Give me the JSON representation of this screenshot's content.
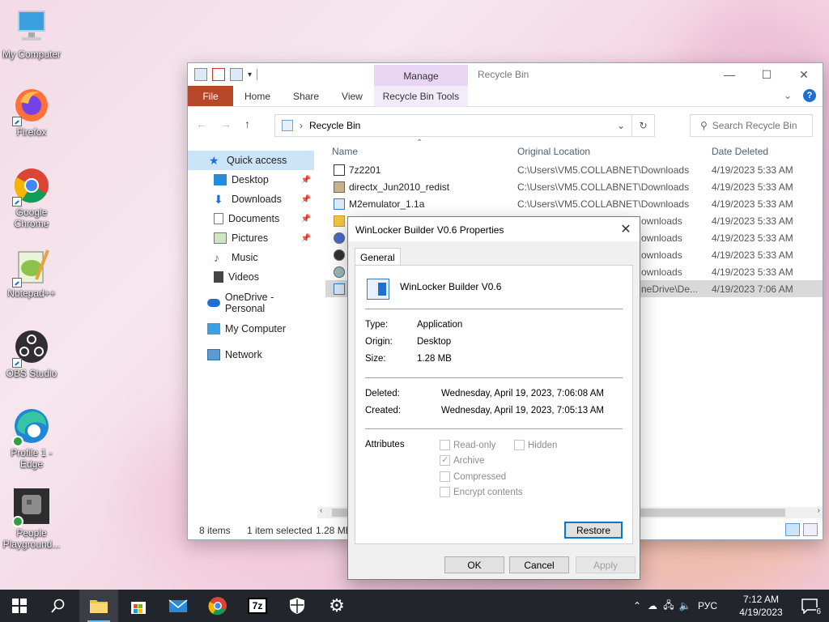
{
  "desktop": {
    "icons": [
      {
        "label": "My Computer"
      },
      {
        "label": "Firefox"
      },
      {
        "label": "Google Chrome"
      },
      {
        "label": "Notepad++"
      },
      {
        "label": "OBS Studio"
      },
      {
        "label": "Profile 1 - Edge"
      },
      {
        "label": "People Playground..."
      }
    ]
  },
  "explorer": {
    "title": "Recycle Bin",
    "contextual_group": "Manage",
    "ribbon_tabs": {
      "file": "File",
      "home": "Home",
      "share": "Share",
      "view": "View",
      "tools": "Recycle Bin Tools"
    },
    "address": {
      "path": "Recycle Bin"
    },
    "search": {
      "placeholder": "Search Recycle Bin"
    },
    "nav": {
      "quick_access": "Quick access",
      "desktop": "Desktop",
      "downloads": "Downloads",
      "documents": "Documents",
      "pictures": "Pictures",
      "music": "Music",
      "videos": "Videos",
      "onedrive": "OneDrive - Personal",
      "my_computer": "My Computer",
      "network": "Network"
    },
    "columns": {
      "name": "Name",
      "original_location": "Original Location",
      "date_deleted": "Date Deleted"
    },
    "files": [
      {
        "name": "7z2201",
        "location": "C:\\Users\\VM5.COLLABNET\\Downloads",
        "date": "4/19/2023 5:33 AM"
      },
      {
        "name": "directx_Jun2010_redist",
        "location": "C:\\Users\\VM5.COLLABNET\\Downloads",
        "date": "4/19/2023 5:33 AM"
      },
      {
        "name": "M2emulator_1.1a",
        "location": "C:\\Users\\VM5.COLLABNET\\Downloads",
        "date": "4/19/2023 5:33 AM"
      },
      {
        "name": "",
        "location": "ownloads",
        "date": "4/19/2023 5:33 AM"
      },
      {
        "name": "",
        "location": "ownloads",
        "date": "4/19/2023 5:33 AM"
      },
      {
        "name": "",
        "location": "ownloads",
        "date": "4/19/2023 5:33 AM"
      },
      {
        "name": "",
        "location": "ownloads",
        "date": "4/19/2023 5:33 AM"
      },
      {
        "name": "",
        "location": "neDrive\\De...",
        "date": "4/19/2023 7:06 AM"
      }
    ],
    "status": {
      "items": "8 items",
      "selected": "1 item selected",
      "size": "1.28 MB"
    }
  },
  "properties": {
    "title": "WinLocker Builder V0.6 Properties",
    "tab": "General",
    "name": "WinLocker Builder V0.6",
    "type_label": "Type:",
    "type_value": "Application",
    "origin_label": "Origin:",
    "origin_value": "Desktop",
    "size_label": "Size:",
    "size_value": "1.28 MB",
    "deleted_label": "Deleted:",
    "deleted_value": "Wednesday, April 19, 2023, 7:06:08 AM",
    "created_label": "Created:",
    "created_value": "Wednesday, April 19, 2023, 7:05:13 AM",
    "attributes_label": "Attributes",
    "attr": {
      "readonly": "Read-only",
      "hidden": "Hidden",
      "archive": "Archive",
      "compressed": "Compressed",
      "encrypt": "Encrypt contents"
    },
    "buttons": {
      "restore": "Restore",
      "ok": "OK",
      "cancel": "Cancel",
      "apply": "Apply"
    }
  },
  "taskbar": {
    "language": "РУС",
    "time": "7:12 AM",
    "date": "4/19/2023",
    "notification_count": "6",
    "sevenzip_label": "7z"
  }
}
